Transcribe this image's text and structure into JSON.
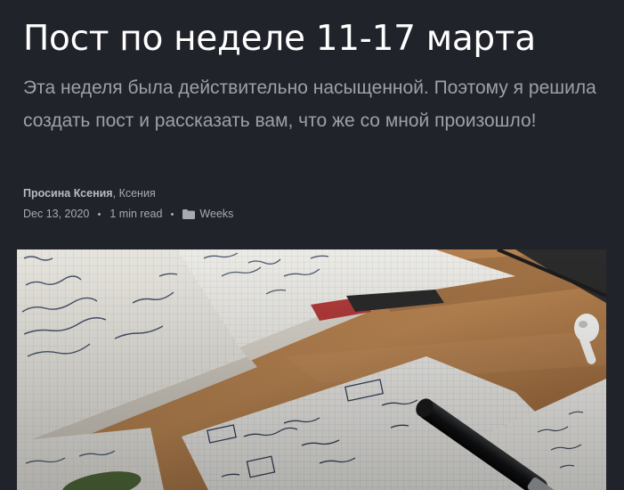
{
  "post": {
    "title": "Пост по неделе 11-17 марта",
    "excerpt": "Эта неделя была действительно насыщенной. Поэтому я решила создать пост и рассказать вам, что же со мной произошло!",
    "authors": {
      "primary": "Просина Ксения",
      "separator": ",",
      "secondary": "Ксения"
    },
    "meta": {
      "date": "Dec 13, 2020",
      "reading_time": "1 min read",
      "tag": "Weeks",
      "tag_icon": "folder-icon"
    },
    "feature_image": {
      "icon": "photo-notebooks-on-desk"
    }
  },
  "colors": {
    "background": "#21232b",
    "title": "#ffffff",
    "excerpt": "#9ea0a7",
    "meta": "#a8aab0"
  }
}
